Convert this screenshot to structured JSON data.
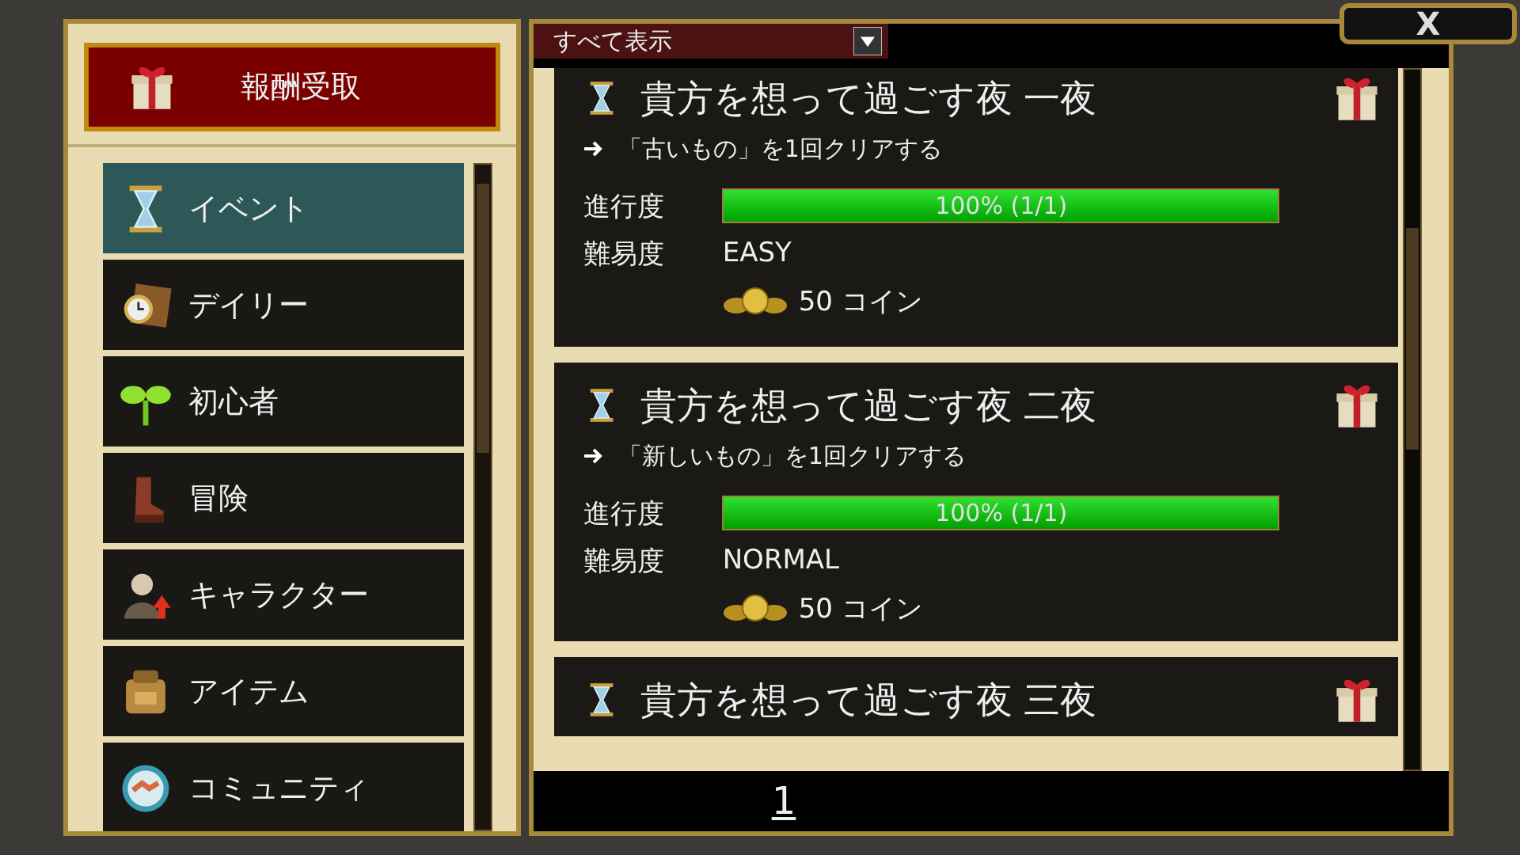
{
  "reward_button": {
    "label": "報酬受取"
  },
  "categories": [
    {
      "label": "イベント",
      "selected": true
    },
    {
      "label": "デイリー",
      "selected": false
    },
    {
      "label": "初心者",
      "selected": false
    },
    {
      "label": "冒険",
      "selected": false
    },
    {
      "label": "キャラクター",
      "selected": false
    },
    {
      "label": "アイテム",
      "selected": false
    },
    {
      "label": "コミュニティ",
      "selected": false
    }
  ],
  "filter": {
    "value": "すべて表示"
  },
  "close_button": {
    "label": "X"
  },
  "quests": [
    {
      "title": "貴方を想って過ごす夜 一夜",
      "objective": "「古いもの」を1回クリアする",
      "progress_label": "進行度",
      "level": 1,
      "progress_text": "100% (1/1)",
      "difficulty_label": "難易度",
      "difficulty": "EASY",
      "reward": "50 コイン"
    },
    {
      "title": "貴方を想って過ごす夜 二夜",
      "objective": "「新しいもの」を1回クリアする",
      "progress_label": "進行度",
      "level": 1,
      "progress_text": "100% (1/1)",
      "difficulty_label": "難易度",
      "difficulty": "NORMAL",
      "reward": "50 コイン"
    },
    {
      "title": "貴方を想って過ごす夜 三夜"
    }
  ],
  "pagination": {
    "page": "1"
  }
}
